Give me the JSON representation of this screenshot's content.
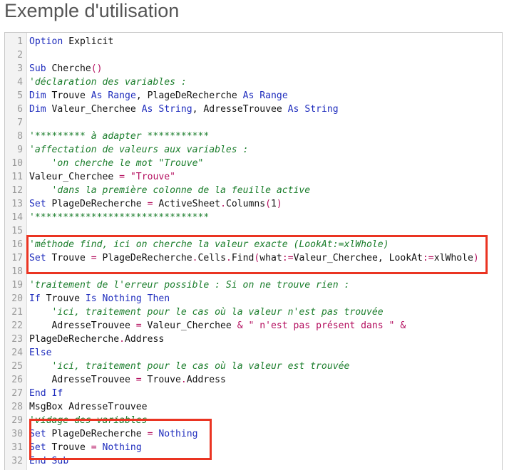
{
  "heading": "Exemple d'utilisation",
  "code_lines": [
    {
      "n": "1",
      "tokens": [
        {
          "t": "Option",
          "c": "kw"
        },
        {
          "t": " Explicit",
          "c": ""
        }
      ]
    },
    {
      "n": "2",
      "tokens": []
    },
    {
      "n": "3",
      "tokens": [
        {
          "t": "Sub",
          "c": "kw"
        },
        {
          "t": " Cherche",
          "c": ""
        },
        {
          "t": "()",
          "c": "op"
        }
      ]
    },
    {
      "n": "4",
      "tokens": [
        {
          "t": "'déclaration des variables :",
          "c": "cm"
        }
      ]
    },
    {
      "n": "5",
      "tokens": [
        {
          "t": "Dim",
          "c": "kw"
        },
        {
          "t": " Trouve ",
          "c": ""
        },
        {
          "t": "As",
          "c": "kw"
        },
        {
          "t": " ",
          "c": ""
        },
        {
          "t": "Range",
          "c": "kw"
        },
        {
          "t": ", PlageDeRecherche ",
          "c": ""
        },
        {
          "t": "As",
          "c": "kw"
        },
        {
          "t": " ",
          "c": ""
        },
        {
          "t": "Range",
          "c": "kw"
        }
      ]
    },
    {
      "n": "6",
      "tokens": [
        {
          "t": "Dim",
          "c": "kw"
        },
        {
          "t": " Valeur_Cherchee ",
          "c": ""
        },
        {
          "t": "As",
          "c": "kw"
        },
        {
          "t": " ",
          "c": ""
        },
        {
          "t": "String",
          "c": "kw"
        },
        {
          "t": ", AdresseTrouvee ",
          "c": ""
        },
        {
          "t": "As",
          "c": "kw"
        },
        {
          "t": " ",
          "c": ""
        },
        {
          "t": "String",
          "c": "kw"
        }
      ]
    },
    {
      "n": "7",
      "tokens": []
    },
    {
      "n": "8",
      "tokens": [
        {
          "t": "'********* à adapter ***********",
          "c": "cm"
        }
      ]
    },
    {
      "n": "9",
      "tokens": [
        {
          "t": "'affectation de valeurs aux variables :",
          "c": "cm"
        }
      ]
    },
    {
      "n": "10",
      "tokens": [
        {
          "t": "    ",
          "c": ""
        },
        {
          "t": "'on cherche le mot \"Trouve\"",
          "c": "cm"
        }
      ]
    },
    {
      "n": "11",
      "tokens": [
        {
          "t": "Valeur_Cherchee ",
          "c": ""
        },
        {
          "t": "=",
          "c": "op"
        },
        {
          "t": " ",
          "c": ""
        },
        {
          "t": "\"Trouve\"",
          "c": "st"
        }
      ]
    },
    {
      "n": "12",
      "tokens": [
        {
          "t": "    ",
          "c": ""
        },
        {
          "t": "'dans la première colonne de la feuille active",
          "c": "cm"
        }
      ]
    },
    {
      "n": "13",
      "tokens": [
        {
          "t": "Set",
          "c": "kw"
        },
        {
          "t": " PlageDeRecherche ",
          "c": ""
        },
        {
          "t": "=",
          "c": "op"
        },
        {
          "t": " ActiveSheet",
          "c": ""
        },
        {
          "t": ".",
          "c": "op"
        },
        {
          "t": "Columns",
          "c": ""
        },
        {
          "t": "(",
          "c": "op"
        },
        {
          "t": "1",
          "c": ""
        },
        {
          "t": ")",
          "c": "op"
        }
      ]
    },
    {
      "n": "14",
      "tokens": [
        {
          "t": "'*******************************",
          "c": "cm"
        }
      ]
    },
    {
      "n": "15",
      "tokens": []
    },
    {
      "n": "16",
      "tokens": [
        {
          "t": "'méthode find, ici on cherche la valeur exacte (LookAt:=xlWhole)",
          "c": "cm"
        }
      ]
    },
    {
      "n": "17",
      "tokens": [
        {
          "t": "Set",
          "c": "kw"
        },
        {
          "t": " Trouve ",
          "c": ""
        },
        {
          "t": "=",
          "c": "op"
        },
        {
          "t": " PlageDeRecherche",
          "c": ""
        },
        {
          "t": ".",
          "c": "op"
        },
        {
          "t": "Cells",
          "c": ""
        },
        {
          "t": ".",
          "c": "op"
        },
        {
          "t": "Find",
          "c": ""
        },
        {
          "t": "(",
          "c": "op"
        },
        {
          "t": "what",
          "c": ""
        },
        {
          "t": ":=",
          "c": "op"
        },
        {
          "t": "Valeur_Cherchee, LookAt",
          "c": ""
        },
        {
          "t": ":=",
          "c": "op"
        },
        {
          "t": "xlWhole",
          "c": ""
        },
        {
          "t": ")",
          "c": "op"
        }
      ]
    },
    {
      "n": "18",
      "tokens": []
    },
    {
      "n": "19",
      "tokens": [
        {
          "t": "'traitement de l'erreur possible : Si on ne trouve rien :",
          "c": "cm"
        }
      ]
    },
    {
      "n": "20",
      "tokens": [
        {
          "t": "If",
          "c": "kw"
        },
        {
          "t": " Trouve ",
          "c": ""
        },
        {
          "t": "Is",
          "c": "kw"
        },
        {
          "t": " ",
          "c": ""
        },
        {
          "t": "Nothing",
          "c": "kw"
        },
        {
          "t": " ",
          "c": ""
        },
        {
          "t": "Then",
          "c": "kw"
        }
      ]
    },
    {
      "n": "21",
      "tokens": [
        {
          "t": "    ",
          "c": ""
        },
        {
          "t": "'ici, traitement pour le cas où la valeur n'est pas trouvée",
          "c": "cm"
        }
      ]
    },
    {
      "n": "22",
      "tokens": [
        {
          "t": "    AdresseTrouvee ",
          "c": ""
        },
        {
          "t": "=",
          "c": "op"
        },
        {
          "t": " Valeur_Cherchee ",
          "c": ""
        },
        {
          "t": "&",
          "c": "op"
        },
        {
          "t": " ",
          "c": ""
        },
        {
          "t": "\" n'est pas présent dans \"",
          "c": "st"
        },
        {
          "t": " ",
          "c": ""
        },
        {
          "t": "&",
          "c": "op"
        }
      ]
    },
    {
      "n": "23",
      "tokens": [
        {
          "t": "PlageDeRecherche",
          "c": ""
        },
        {
          "t": ".",
          "c": "op"
        },
        {
          "t": "Address",
          "c": ""
        }
      ]
    },
    {
      "n": "24",
      "tokens": [
        {
          "t": "Else",
          "c": "kw"
        }
      ]
    },
    {
      "n": "25",
      "tokens": [
        {
          "t": "    ",
          "c": ""
        },
        {
          "t": "'ici, traitement pour le cas où la valeur est trouvée",
          "c": "cm"
        }
      ]
    },
    {
      "n": "26",
      "tokens": [
        {
          "t": "    AdresseTrouvee ",
          "c": ""
        },
        {
          "t": "=",
          "c": "op"
        },
        {
          "t": " Trouve",
          "c": ""
        },
        {
          "t": ".",
          "c": "op"
        },
        {
          "t": "Address",
          "c": ""
        }
      ]
    },
    {
      "n": "27",
      "tokens": [
        {
          "t": "End",
          "c": "kw"
        },
        {
          "t": " ",
          "c": ""
        },
        {
          "t": "If",
          "c": "kw"
        }
      ]
    },
    {
      "n": "28",
      "tokens": [
        {
          "t": "MsgBox AdresseTrouvee",
          "c": ""
        }
      ]
    },
    {
      "n": "29",
      "tokens": [
        {
          "t": "'vidage des variables",
          "c": "cm"
        }
      ]
    },
    {
      "n": "30",
      "tokens": [
        {
          "t": "Set",
          "c": "kw"
        },
        {
          "t": " PlageDeRecherche ",
          "c": ""
        },
        {
          "t": "=",
          "c": "op"
        },
        {
          "t": " ",
          "c": ""
        },
        {
          "t": "Nothing",
          "c": "kw"
        }
      ]
    },
    {
      "n": "31",
      "tokens": [
        {
          "t": "Set",
          "c": "kw"
        },
        {
          "t": " Trouve ",
          "c": ""
        },
        {
          "t": "=",
          "c": "op"
        },
        {
          "t": " ",
          "c": ""
        },
        {
          "t": "Nothing",
          "c": "kw"
        }
      ]
    },
    {
      "n": "32",
      "tokens": [
        {
          "t": "End",
          "c": "kw"
        },
        {
          "t": " ",
          "c": ""
        },
        {
          "t": "Sub",
          "c": "kw"
        }
      ]
    }
  ],
  "highlight_color": "#ea3422"
}
